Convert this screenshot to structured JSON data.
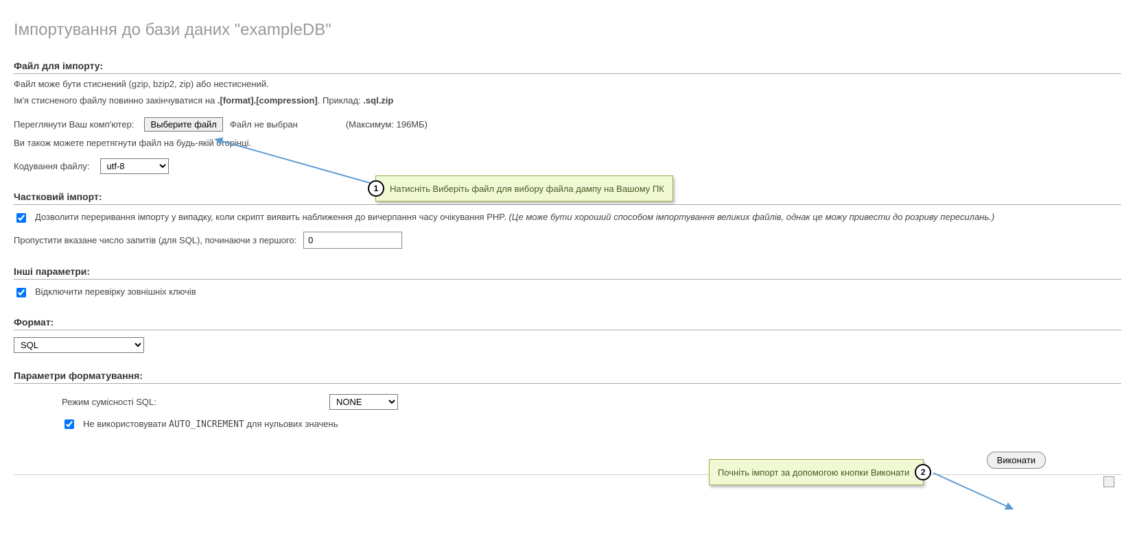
{
  "title": "Імпортування до бази даних \"exampleDB\"",
  "sections": {
    "file": {
      "header": "Файл для імпорту:",
      "line1": "Файл може бути стиснений (gzip, bzip2, zip) або нестиснений.",
      "line2_pre": "Ім'я стисненого файлу повинно закінчуватися на ",
      "line2_bold1": ".[format].[compression]",
      "line2_mid": ". Приклад: ",
      "line2_bold2": ".sql.zip",
      "browse_label": "Переглянути Ваш комп'ютер:",
      "browse_button": "Выберите файл",
      "file_status": "Файл не выбран",
      "max_size": "(Максимум: 196МБ)",
      "drag_hint": "Ви також можете перетягнути файл на будь-якій сторінці.",
      "encoding_label": "Кодування файлу:",
      "encoding_value": "utf-8"
    },
    "partial": {
      "header": "Частковий імпорт:",
      "allow_break_pre": "Дозволити переривання імпорту у випадку, коли скрипт виявить наближення до вичерпання часу очікування PHP. ",
      "allow_break_note": "(Це може бути хороший способом імпортування великих файлів, однак це можу привести до розриву пересилань.)",
      "skip_label": "Пропустити вказане число запитів (для SQL), починаючи з першого:",
      "skip_value": "0"
    },
    "other": {
      "header": "Інші параметри:",
      "fk_label": "Відключити перевірку зовнішніх ключів"
    },
    "format": {
      "header": "Формат:",
      "value": "SQL"
    },
    "fmt_params": {
      "header": "Параметри форматування:",
      "compat_label": "Режим сумісності SQL:",
      "compat_value": "NONE",
      "noai_pre": "Не використовувати ",
      "noai_mono": "AUTO_INCREMENT",
      "noai_post": " для нульових значень"
    }
  },
  "submit_label": "Виконати",
  "callouts": {
    "c1": {
      "num": "1",
      "text": "Натисніть Виберіть файл для вибору файла дампу на Вашому ПК"
    },
    "c2": {
      "num": "2",
      "text": "Почніть імпорт за допомогою кнопки Виконати"
    }
  }
}
